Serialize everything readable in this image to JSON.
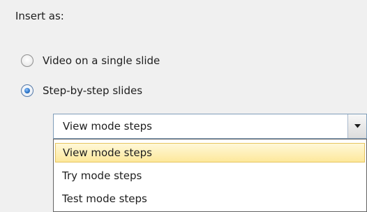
{
  "heading": "Insert as:",
  "options": [
    {
      "label": "Video on a single slide",
      "selected": false
    },
    {
      "label": "Step-by-step slides",
      "selected": true
    }
  ],
  "select": {
    "value": "View mode steps",
    "arrow_icon": "chevron-down-icon"
  },
  "dropdown": {
    "items": [
      {
        "label": "View mode steps",
        "highlighted": true
      },
      {
        "label": "Try mode steps",
        "highlighted": false
      },
      {
        "label": "Test mode steps",
        "highlighted": false
      }
    ]
  },
  "colors": {
    "highlight": "#fde89b",
    "select_border": "#7f9db9",
    "radio_dot": "#2d76c9"
  }
}
